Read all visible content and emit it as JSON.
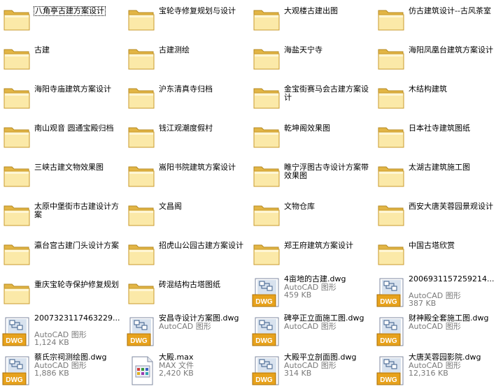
{
  "folders": [
    {
      "name": "八角亭古建方案设计",
      "selected": true
    },
    {
      "name": "宝轮寺修复规划与设计"
    },
    {
      "name": "大观楼古建出图"
    },
    {
      "name": "仿古建筑设计--古风茶室"
    },
    {
      "name": "古建"
    },
    {
      "name": "古建测绘"
    },
    {
      "name": "海盐天宁寺"
    },
    {
      "name": "海阳凤凰台建筑方案设计"
    },
    {
      "name": "海阳寺庙建筑方案设计"
    },
    {
      "name": "沪东清真寺归档"
    },
    {
      "name": "金宝街赛马会古建方案设计"
    },
    {
      "name": "木结构建筑"
    },
    {
      "name": "南山观音 圆通宝殿归档"
    },
    {
      "name": "钱江观潮度假村"
    },
    {
      "name": "乾坤阁效果图"
    },
    {
      "name": "日本社寺建筑图纸"
    },
    {
      "name": "三峡古建文物效果图"
    },
    {
      "name": "嵩阳书院建筑方案设计"
    },
    {
      "name": "睢宁浮图古寺设计方案带效果图"
    },
    {
      "name": "太湖古建筑施工图"
    },
    {
      "name": "太原中堡街市古建设计方案"
    },
    {
      "name": "文昌阁"
    },
    {
      "name": "文物仓库"
    },
    {
      "name": "西安大唐芙蓉园景观设计"
    },
    {
      "name": "瀛台宫古建门头设计方案"
    },
    {
      "name": "招虎山公园古建方案设计"
    },
    {
      "name": "郑王府建筑方案设计"
    },
    {
      "name": "中国古塔欣赏"
    },
    {
      "name": "重庆宝轮寺保护修复规划"
    },
    {
      "name": "砖混结构古塔图纸"
    }
  ],
  "files": [
    {
      "name": "4亩地的古建.dwg",
      "type": "AutoCAD 图形",
      "size": "459 KB",
      "icon": "dwg-icon"
    },
    {
      "name": "2006931157259214...",
      "type": "AutoCAD 图形",
      "size": "387 KB",
      "icon": "dwg-icon"
    },
    {
      "name": "2007323117463229...",
      "type": "AutoCAD 图形",
      "size": "1,124 KB",
      "icon": "dwg-icon"
    },
    {
      "name": "安昌寺设计方案图.dwg",
      "type": "AutoCAD 图形",
      "size": "",
      "icon": "dwg-icon"
    },
    {
      "name": "碑亭正立面施工图.dwg",
      "type": "AutoCAD 图形",
      "size": "",
      "icon": "dwg-icon"
    },
    {
      "name": "财神殿全套施工图.dwg",
      "type": "AutoCAD 图形",
      "size": "",
      "icon": "dwg-icon"
    },
    {
      "name": "蔡氏宗祠测绘图.dwg",
      "type": "AutoCAD 图形",
      "size": "1,886 KB",
      "icon": "dwg-icon"
    },
    {
      "name": "大殿.max",
      "type": "MAX 文件",
      "size": "2,420 KB",
      "icon": "max-file-icon"
    },
    {
      "name": "大殿平立剖面图.dwg",
      "type": "AutoCAD 图形",
      "size": "314 KB",
      "icon": "dwg-icon"
    },
    {
      "name": "大唐芙蓉园影院.dwg",
      "type": "AutoCAD 图形",
      "size": "12,316 KB",
      "icon": "dwg-icon"
    }
  ],
  "dwg_badge": "DWG",
  "colors": {
    "folder_light": "#fbe9a8",
    "folder_dark": "#e2b545",
    "dwg_badge": "#e7a21c",
    "subtext": "#7a7a7a"
  }
}
